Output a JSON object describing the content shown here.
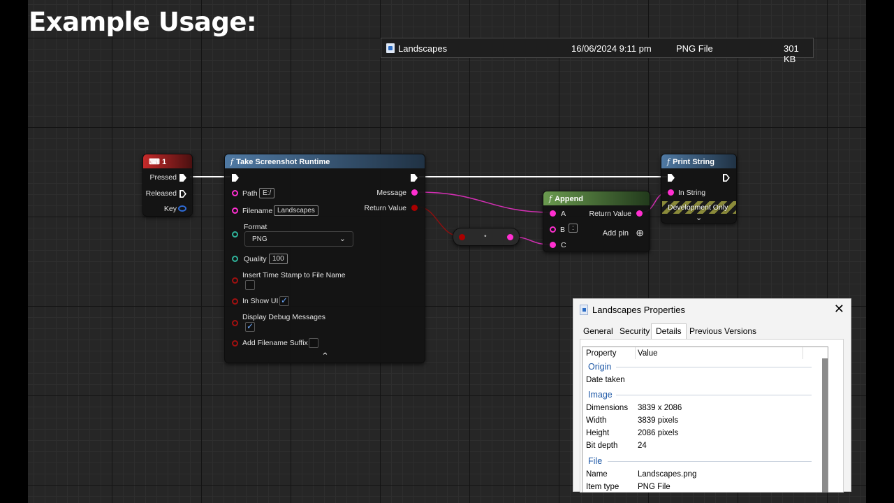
{
  "page_title": "Example Usage:",
  "file_row": {
    "name": "Landscapes",
    "date": "16/06/2024 9:11 pm",
    "type": "PNG File",
    "size": "301 KB"
  },
  "key_node": {
    "title": "1",
    "pins": [
      "Pressed",
      "Released",
      "Key"
    ]
  },
  "screenshot_node": {
    "title": "Take Screenshot Runtime",
    "path_label": "Path",
    "path_value": "E:/",
    "filename_label": "Filename",
    "filename_value": "Landscapes",
    "format_label": "Format",
    "format_value": "PNG",
    "quality_label": "Quality",
    "quality_value": "100",
    "timestamp_label": "Insert Time Stamp to File Name",
    "show_ui_label": "In Show UI",
    "debug_label": "Display Debug Messages",
    "suffix_label": "Add Filename Suffix",
    "message_label": "Message",
    "return_label": "Return Value"
  },
  "append_node": {
    "title": "Append",
    "a_label": "A",
    "b_label": "B",
    "b_value": ":",
    "c_label": "C",
    "return_label": "Return Value",
    "add_pin_label": "Add pin"
  },
  "print_node": {
    "title": "Print String",
    "in_string_label": "In String",
    "dev_only_label": "Development Only"
  },
  "properties": {
    "title": "Landscapes Properties",
    "tabs": [
      "General",
      "Security",
      "Details",
      "Previous Versions"
    ],
    "columns": [
      "Property",
      "Value"
    ],
    "groups": {
      "origin": "Origin",
      "image": "Image",
      "file": "File"
    },
    "origin_rows": [
      {
        "k": "Date taken",
        "v": ""
      }
    ],
    "image_rows": [
      {
        "k": "Dimensions",
        "v": "3839 x 2086"
      },
      {
        "k": "Width",
        "v": "3839 pixels"
      },
      {
        "k": "Height",
        "v": "2086 pixels"
      },
      {
        "k": "Bit depth",
        "v": "24"
      }
    ],
    "file_rows": [
      {
        "k": "Name",
        "v": "Landscapes.png"
      },
      {
        "k": "Item type",
        "v": "PNG File"
      }
    ]
  },
  "colors": {
    "string_pin": "#ff2fd0",
    "exec_wire": "#ffffff",
    "function_header": "#4f79a3",
    "event_header": "#c62a2a",
    "pure_header": "#6a9a4f"
  }
}
